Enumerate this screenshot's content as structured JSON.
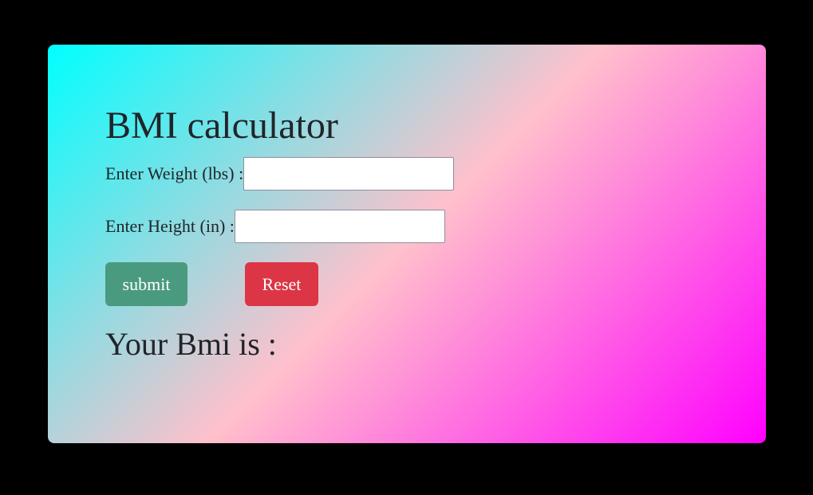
{
  "page": {
    "background_color": "#000000"
  },
  "card": {
    "gradient_colors": [
      "#00ffff",
      "#ffc0cb",
      "#ff00ff"
    ],
    "title": "BMI calculator",
    "weight_label": "Enter Weight (lbs) :",
    "weight_value": "",
    "height_label": "Enter Height (in) :",
    "height_value": "",
    "submit_label": "submit",
    "submit_color": "#4a9a80",
    "reset_label": "Reset",
    "reset_color": "#dc3545",
    "result_text": "Your Bmi is :"
  }
}
